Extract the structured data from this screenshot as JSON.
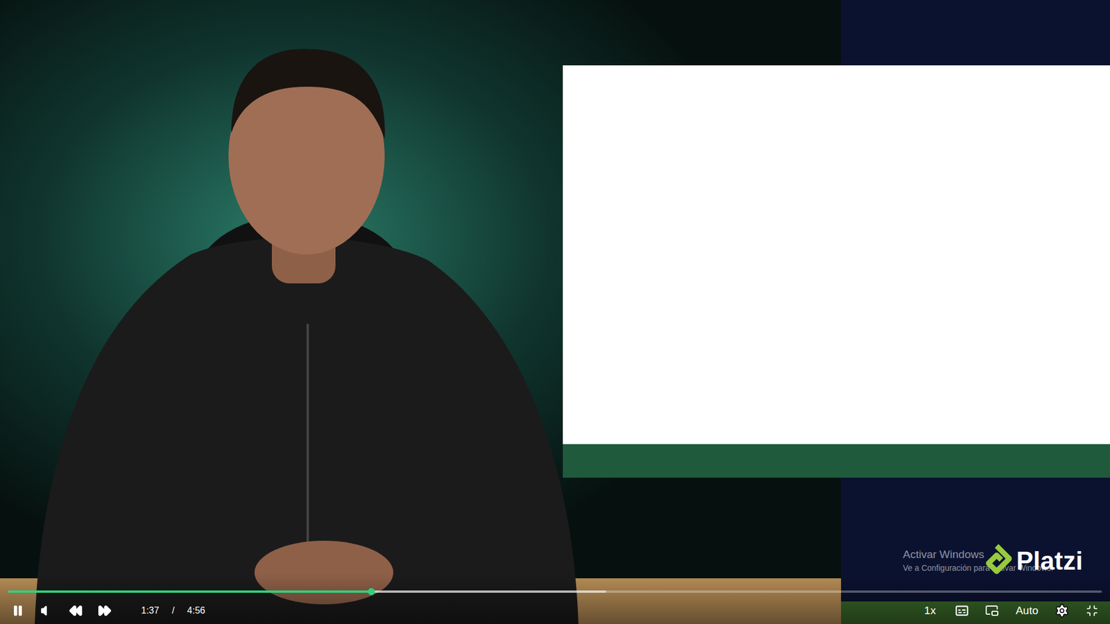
{
  "player": {
    "playing": true,
    "progress": {
      "level": 0.332,
      "buffered": 0.547
    },
    "time": {
      "current": "1:37",
      "separator": "/",
      "duration": "4:56"
    },
    "speed": "1x",
    "quality": "Auto",
    "captions": false,
    "fullscreen": true
  },
  "watermark": {
    "title": "Activar Windows",
    "subtitle": "Ve a Configuración para activar Windows."
  },
  "logo": {
    "text": "Platzi"
  }
}
